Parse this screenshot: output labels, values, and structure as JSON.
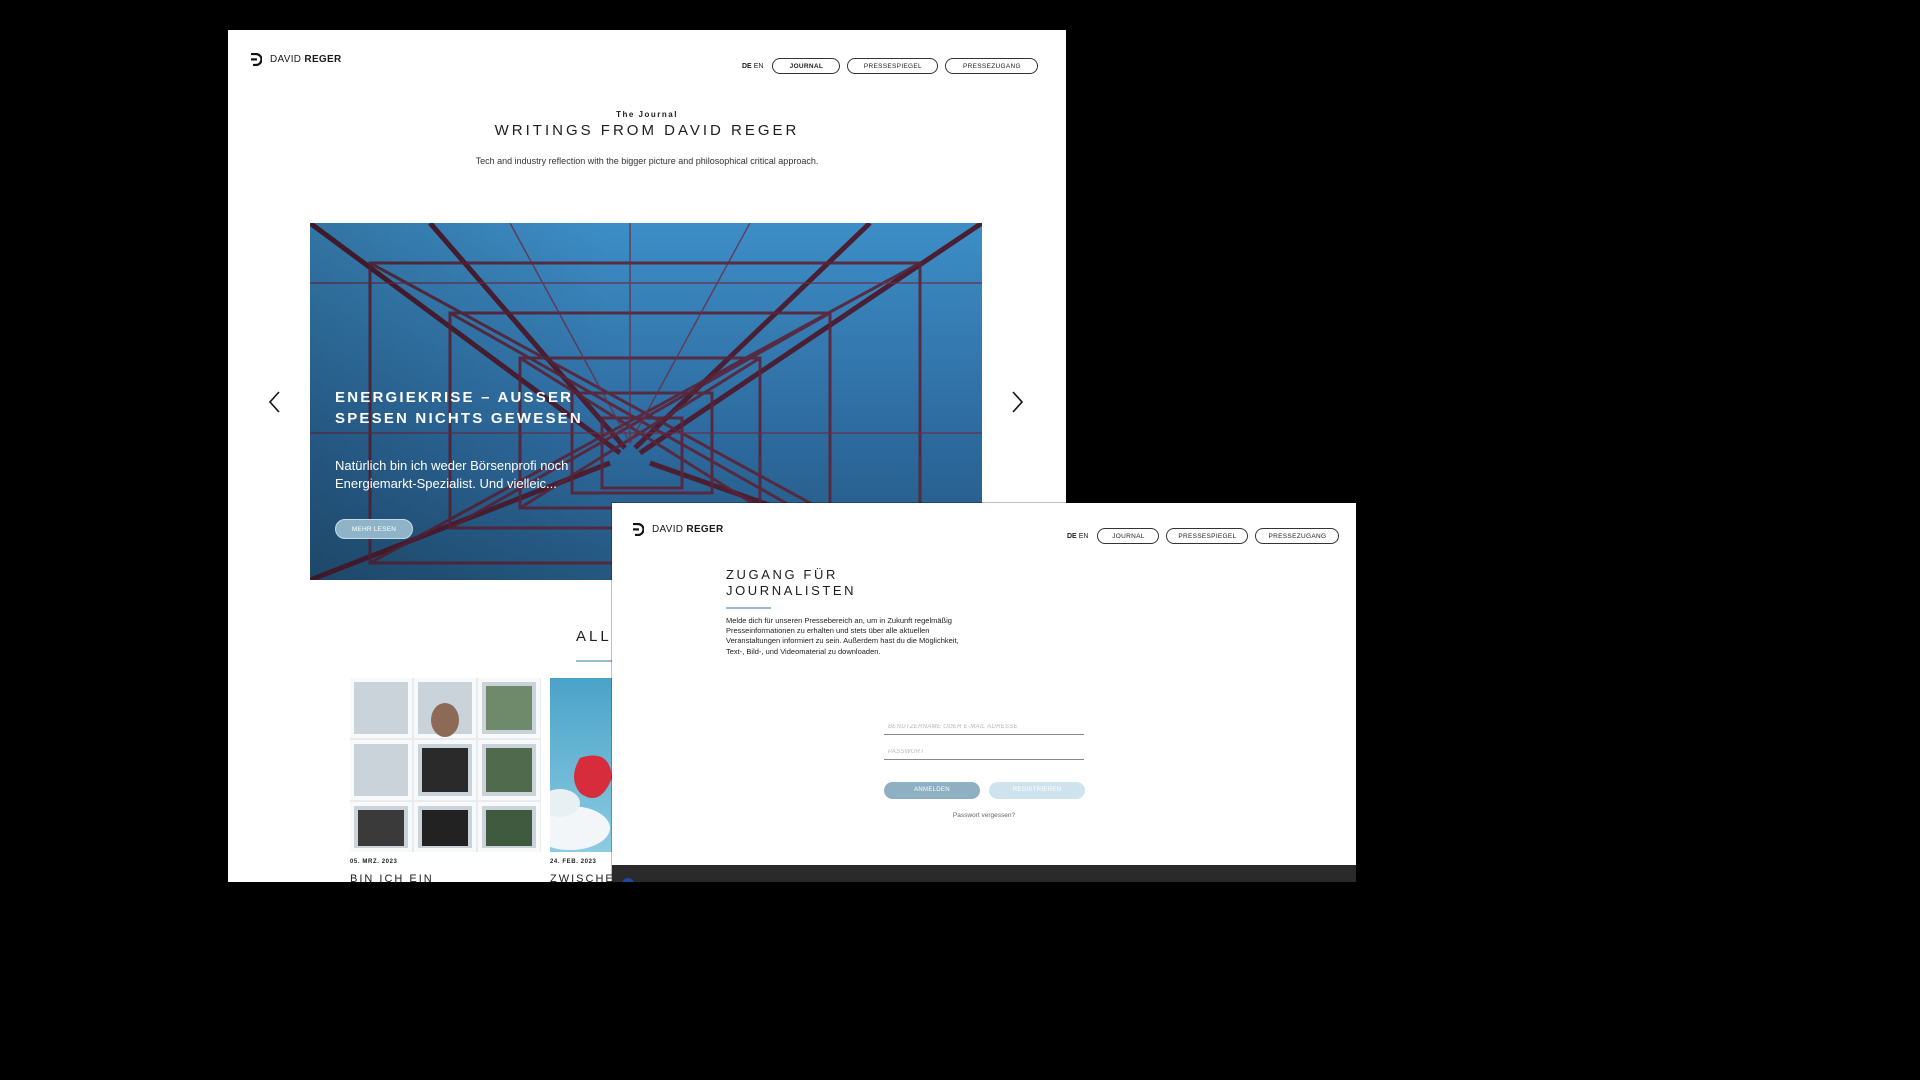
{
  "win1": {
    "logo": {
      "name_light": "DAVID",
      "name_bold": "REGER"
    },
    "nav": {
      "lang_de": "DE",
      "lang_en": "EN",
      "items": [
        {
          "label": "JOURNAL",
          "active": true
        },
        {
          "label": "PRESSESPIEGEL"
        },
        {
          "label": "PRESSEZUGANG"
        }
      ]
    },
    "eyebrow": "The Journal",
    "title": "WRITINGS FROM DAVID REGER",
    "subtitle": "Tech and industry reflection with the bigger picture and philosophical critical approach.",
    "hero": {
      "title": "ENERGIEKRISE – AUSSER SPESEN NICHTS GEWESEN",
      "excerpt": "Natürlich bin ich weder Börsenprofi noch Energiemarkt-Spezialist. Und vielleic...",
      "button": "MEHR LESEN"
    },
    "section_heading": "ALL",
    "cards": [
      {
        "date": "05. MRZ. 2023",
        "title": "BIN ICH EIN"
      },
      {
        "date": "24. FEB. 2023",
        "title": "ZWISCHE"
      }
    ]
  },
  "win2": {
    "logo": {
      "name_light": "DAVID",
      "name_bold": "REGER"
    },
    "nav": {
      "lang_de": "DE",
      "lang_en": "EN",
      "items": [
        {
          "label": "JOURNAL"
        },
        {
          "label": "PRESSESPIEGEL"
        },
        {
          "label": "PRESSEZUGANG"
        }
      ]
    },
    "title": "ZUGANG FÜR JOURNALISTEN",
    "text": "Melde dich für unseren Pressebereich an, um in Zukunft regelmäßig Presseinformationen zu erhalten und stets über alle aktuellen Veranstaltungen informiert zu sein. Außerdem hast du die Möglichkeit, Text-, Bild-, und Videomaterial zu downloaden.",
    "form": {
      "username_placeholder": "BENUTZERNAME ODER E-MAIL ADRESSE",
      "password_placeholder": "PASSWORT",
      "login": "ANMELDEN",
      "register": "REGISTRIEREN",
      "forgot": "Passwort vergessen?"
    }
  }
}
